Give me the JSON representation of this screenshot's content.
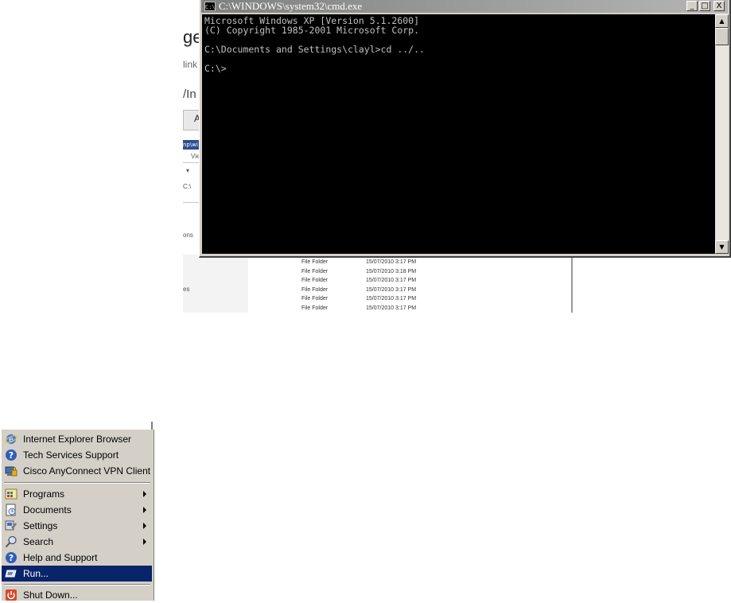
{
  "background_window": {
    "heading_fragment": "ge",
    "link_fragment": "link",
    "path_fragment": "/In",
    "toolbar_fragment": "A",
    "blue_fragment": "np\\wi",
    "view_fragment": "Vie",
    "address_fragment": "C:\\",
    "pane_fragment_1": "ons",
    "pane_fragment_2": "es",
    "file_rows": [
      {
        "type": "File Folder",
        "date": "15/07/2010 3:17 PM"
      },
      {
        "type": "File Folder",
        "date": "15/07/2010 3:18 PM"
      },
      {
        "type": "File Folder",
        "date": "15/07/2010 3:17 PM"
      },
      {
        "type": "File Folder",
        "date": "15/07/2010 3:17 PM"
      },
      {
        "type": "File Folder",
        "date": "15/07/2010 3:17 PM"
      },
      {
        "type": "File Folder",
        "date": "15/07/2010 3:17 PM"
      }
    ]
  },
  "cmd_window": {
    "icon_text": "C:\\",
    "title": "C:\\WINDOWS\\system32\\cmd.exe",
    "controls": {
      "minimize": "_",
      "maximize": "□",
      "close": "X"
    },
    "lines": [
      "Microsoft Windows XP [Version 5.1.2600]",
      "(C) Copyright 1985-2001 Microsoft Corp.",
      "",
      "C:\\Documents and Settings\\clayl>cd ../..",
      "",
      "C:\\>"
    ],
    "scroll": {
      "up": "▲",
      "down": "▼"
    }
  },
  "start_menu": {
    "pinned": [
      {
        "label": "Internet Explorer Browser",
        "icon": "ie-icon"
      },
      {
        "label": "Tech Services Support",
        "icon": "help-icon"
      },
      {
        "label": "Cisco AnyConnect VPN Client",
        "icon": "vpn-icon"
      }
    ],
    "items": [
      {
        "label": "Programs",
        "icon": "programs-icon",
        "submenu": true
      },
      {
        "label": "Documents",
        "icon": "documents-icon",
        "submenu": true
      },
      {
        "label": "Settings",
        "icon": "settings-icon",
        "submenu": true
      },
      {
        "label": "Search",
        "icon": "search-icon",
        "submenu": true
      },
      {
        "label": "Help and Support",
        "icon": "help-icon",
        "submenu": false
      },
      {
        "label": "Run...",
        "icon": "run-icon",
        "submenu": false,
        "selected": true
      }
    ],
    "shutdown": {
      "label": "Shut Down...",
      "icon": "shutdown-icon"
    }
  },
  "colors": {
    "menu_bg": "#d4d0c8",
    "selection": "#0a246a",
    "console_bg": "#000000",
    "console_fg": "#c0c0c0"
  }
}
